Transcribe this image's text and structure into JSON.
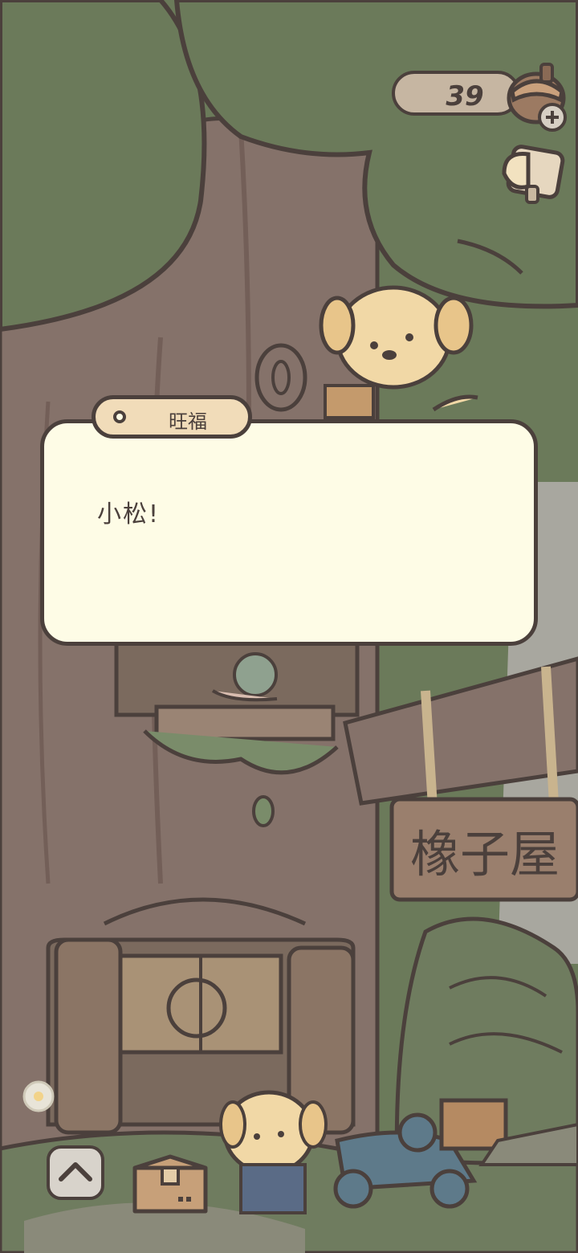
{
  "hud": {
    "acorn_count": "39",
    "icons": [
      "acorn-icon",
      "plus-icon",
      "lamp-icon"
    ]
  },
  "dialog": {
    "speaker": "旺福",
    "text": "小松!"
  },
  "scene": {
    "sign_text": "橡子屋"
  },
  "bottom_bar": {
    "icons": [
      "chevron-up-icon",
      "box-icon"
    ]
  },
  "colors": {
    "outline": "#4b403c",
    "dialog_bg": "#fefce6",
    "name_tag_bg": "#f1dcb9",
    "leaves": "#6b7a5a",
    "trunk": "#85726a"
  }
}
